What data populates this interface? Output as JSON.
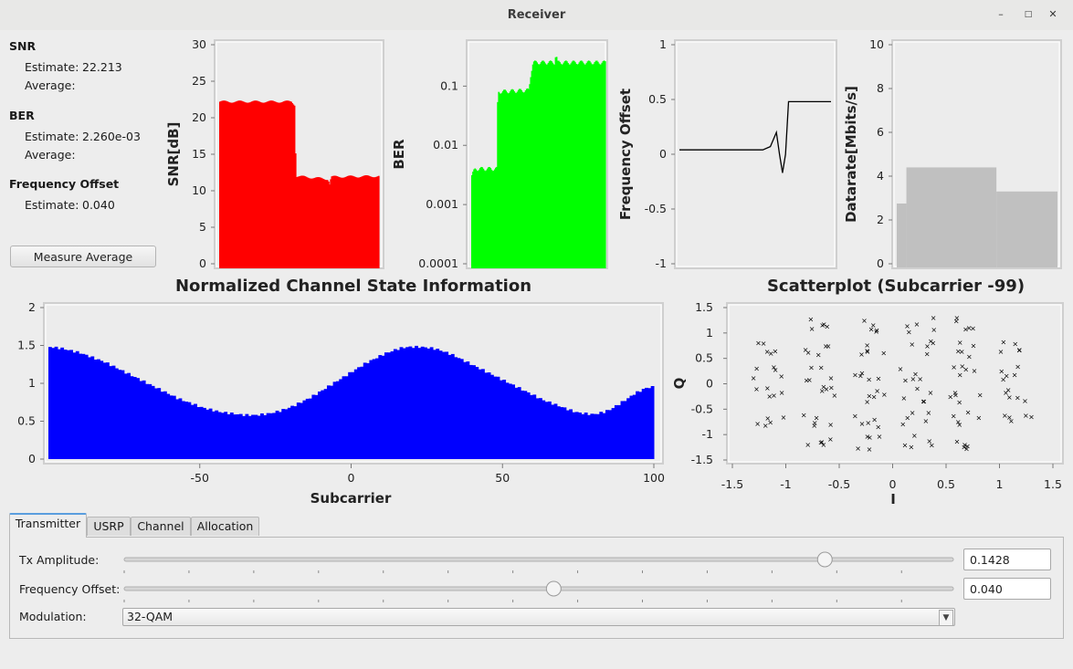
{
  "window": {
    "title": "Receiver",
    "btn_min": "–",
    "btn_max": "□",
    "btn_close": "✕"
  },
  "stats": {
    "snr": {
      "heading": "SNR",
      "estimate_label": "Estimate:",
      "estimate_value": "22.213",
      "average_label": "Average:"
    },
    "ber": {
      "heading": "BER",
      "estimate_label": "Estimate:",
      "estimate_value": "2.260e-03",
      "average_label": "Average:"
    },
    "freq": {
      "heading": "Frequency Offset",
      "estimate_label": "Estimate:",
      "estimate_value": "0.040"
    },
    "measure_button": "Measure Average"
  },
  "chart_data": [
    {
      "id": "snr",
      "type": "area",
      "ylabel": "SNR[dB]",
      "ylim": [
        0,
        30
      ],
      "yticks": [
        "0",
        "5",
        "10",
        "15",
        "20",
        "25",
        "30"
      ],
      "color": "#ff0000",
      "profile": [
        [
          0,
          22.2
        ],
        [
          0.45,
          22.2
        ],
        [
          0.47,
          21.8
        ],
        [
          0.48,
          12.0
        ],
        [
          0.68,
          11.6
        ],
        [
          0.69,
          10.9
        ],
        [
          0.7,
          11.9
        ],
        [
          1,
          12.0
        ]
      ]
    },
    {
      "id": "ber",
      "type": "area",
      "ylabel": "BER",
      "scale": "log",
      "ylim": [
        0.0001,
        0.5
      ],
      "yticks": [
        "0.0001",
        "0.001",
        "0.01",
        "0.1"
      ],
      "color": "#00ff00",
      "profile": [
        [
          0,
          0.003
        ],
        [
          0.03,
          0.004
        ],
        [
          0.19,
          0.004
        ],
        [
          0.2,
          0.08
        ],
        [
          0.43,
          0.085
        ],
        [
          0.46,
          0.25
        ],
        [
          0.62,
          0.25
        ],
        [
          0.63,
          0.35
        ],
        [
          0.64,
          0.25
        ],
        [
          1,
          0.25
        ]
      ]
    },
    {
      "id": "freq",
      "type": "line",
      "ylabel": "Frequency Offset",
      "ylim": [
        -1,
        1
      ],
      "yticks": [
        "-1",
        "-0.5",
        "0",
        "0.5",
        "1"
      ],
      "color": "#000000",
      "profile": [
        [
          0,
          0.04
        ],
        [
          0.55,
          0.04
        ],
        [
          0.6,
          0.07
        ],
        [
          0.64,
          0.2
        ],
        [
          0.66,
          0.0
        ],
        [
          0.68,
          -0.17
        ],
        [
          0.7,
          0.0
        ],
        [
          0.72,
          0.48
        ],
        [
          1,
          0.48
        ]
      ]
    },
    {
      "id": "datarate",
      "type": "bar",
      "ylabel": "Datarate[Mbits/s]",
      "ylim": [
        0,
        10
      ],
      "yticks": [
        "0",
        "2",
        "4",
        "6",
        "8",
        "10"
      ],
      "color": "#c0c0c0",
      "bars": [
        [
          0,
          0.06,
          2.75
        ],
        [
          0.06,
          0.62,
          4.4
        ],
        [
          0.62,
          1,
          3.3
        ]
      ]
    },
    {
      "id": "csi",
      "type": "bar",
      "title": "Normalized Channel State Information",
      "xlabel": "Subcarrier",
      "xlim": [
        -100,
        100
      ],
      "xticks": [
        "-50",
        "0",
        "50",
        "100"
      ],
      "ylim": [
        0,
        2
      ],
      "yticks": [
        "0",
        "0.5",
        "1",
        "1.5",
        "2"
      ],
      "color": "#0000ff",
      "values": [
        1.48,
        1.47,
        1.46,
        1.44,
        1.42,
        1.4,
        1.37,
        1.34,
        1.31,
        1.28,
        1.24,
        1.2,
        1.16,
        1.12,
        1.08,
        1.04,
        1.0,
        0.96,
        0.92,
        0.88,
        0.84,
        0.8,
        0.77,
        0.74,
        0.71,
        0.68,
        0.66,
        0.64,
        0.62,
        0.61,
        0.6,
        0.59,
        0.58,
        0.58,
        0.58,
        0.59,
        0.6,
        0.62,
        0.64,
        0.67,
        0.7,
        0.74,
        0.78,
        0.82,
        0.87,
        0.92,
        0.97,
        1.02,
        1.07,
        1.12,
        1.17,
        1.22,
        1.27,
        1.31,
        1.35,
        1.39,
        1.42,
        1.45,
        1.47,
        1.48,
        1.48,
        1.48,
        1.47,
        1.46,
        1.44,
        1.41,
        1.38,
        1.34,
        1.3,
        1.26,
        1.22,
        1.18,
        1.14,
        1.1,
        1.06,
        1.02,
        0.98,
        0.94,
        0.9,
        0.86,
        0.82,
        0.78,
        0.75,
        0.72,
        0.69,
        0.66,
        0.63,
        0.61,
        0.6,
        0.59,
        0.6,
        0.62,
        0.65,
        0.7,
        0.75,
        0.8,
        0.86,
        0.9,
        0.94,
        0.95
      ]
    },
    {
      "id": "scatter",
      "type": "scatter",
      "title": "Scatterplot (Subcarrier -99)",
      "xlabel": "I",
      "ylabel": "Q",
      "xlim": [
        -1.5,
        1.5
      ],
      "ylim": [
        -1.5,
        1.5
      ],
      "xticks": [
        "-1.5",
        "-1",
        "-0.5",
        "0",
        "0.5",
        "1",
        "1.5"
      ],
      "yticks": [
        "-1.5",
        "-1",
        "-0.5",
        "0",
        "0.5",
        "1",
        "1.5"
      ],
      "color": "#000000",
      "clusters": [
        [
          -0.64,
          1.16
        ],
        [
          -0.2,
          1.16
        ],
        [
          0.25,
          1.16
        ],
        [
          0.7,
          1.16
        ],
        [
          -1.13,
          0.68
        ],
        [
          -0.68,
          0.7
        ],
        [
          -0.22,
          0.66
        ],
        [
          0.25,
          0.7
        ],
        [
          0.7,
          0.68
        ],
        [
          1.16,
          0.68
        ],
        [
          -1.16,
          0.22
        ],
        [
          -0.68,
          0.22
        ],
        [
          -0.22,
          0.22
        ],
        [
          0.22,
          0.22
        ],
        [
          0.7,
          0.22
        ],
        [
          1.16,
          0.22
        ],
        [
          -1.16,
          -0.22
        ],
        [
          -0.66,
          -0.2
        ],
        [
          -0.22,
          -0.22
        ],
        [
          0.24,
          -0.24
        ],
        [
          0.68,
          -0.22
        ],
        [
          1.14,
          -0.24
        ],
        [
          -1.14,
          -0.68
        ],
        [
          -0.7,
          -0.68
        ],
        [
          -0.24,
          -0.7
        ],
        [
          0.22,
          -0.7
        ],
        [
          0.68,
          -0.7
        ],
        [
          1.16,
          -0.68
        ],
        [
          -0.68,
          -1.16
        ],
        [
          -0.2,
          -1.16
        ],
        [
          0.25,
          -1.16
        ],
        [
          0.68,
          -1.14
        ]
      ]
    }
  ],
  "tabs": [
    "Transmitter",
    "USRP",
    "Channel",
    "Allocation"
  ],
  "controls": {
    "tx_label": "Tx Amplitude:",
    "tx_value": "0.1428",
    "tx_slider": 0.845,
    "freq_label": "Frequency Offset:",
    "freq_value": "0.040",
    "freq_slider": 0.518,
    "mod_label": "Modulation:",
    "mod_value": "32-QAM"
  }
}
